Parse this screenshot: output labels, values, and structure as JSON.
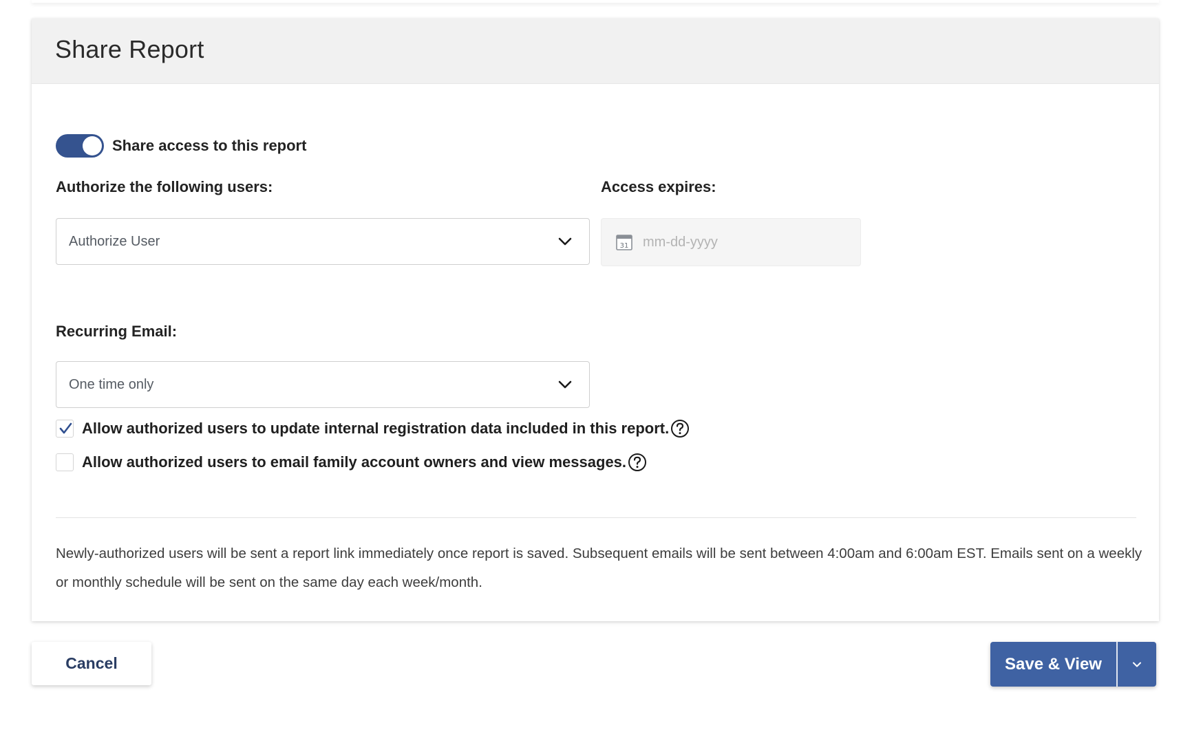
{
  "dialog": {
    "title": "Share Report"
  },
  "share_toggle": {
    "label": "Share access to this report",
    "enabled": true
  },
  "authorize_users": {
    "label": "Authorize the following users:",
    "value": "Authorize User"
  },
  "access_expires": {
    "label": "Access expires:",
    "placeholder": "mm-dd-yyyy",
    "calendar_day": "31"
  },
  "recurring_email": {
    "label": "Recurring Email:",
    "value": "One time only"
  },
  "options": [
    {
      "label": "Allow authorized users to update internal registration data included in this report.",
      "checked": true
    },
    {
      "label": "Allow authorized users to email family account owners and view messages.",
      "checked": false
    }
  ],
  "info_text": "Newly-authorized users will be sent a report link immediately once report is saved. Subsequent emails will be sent between 4:00am and 6:00am EST. Emails sent on a weekly or monthly schedule will be sent on the same day each week/month.",
  "footer": {
    "cancel_label": "Cancel",
    "save_label": "Save & View"
  },
  "colors": {
    "accent": "#35538f",
    "primary_button": "#3f62a3",
    "check": "#2f4f8f"
  }
}
